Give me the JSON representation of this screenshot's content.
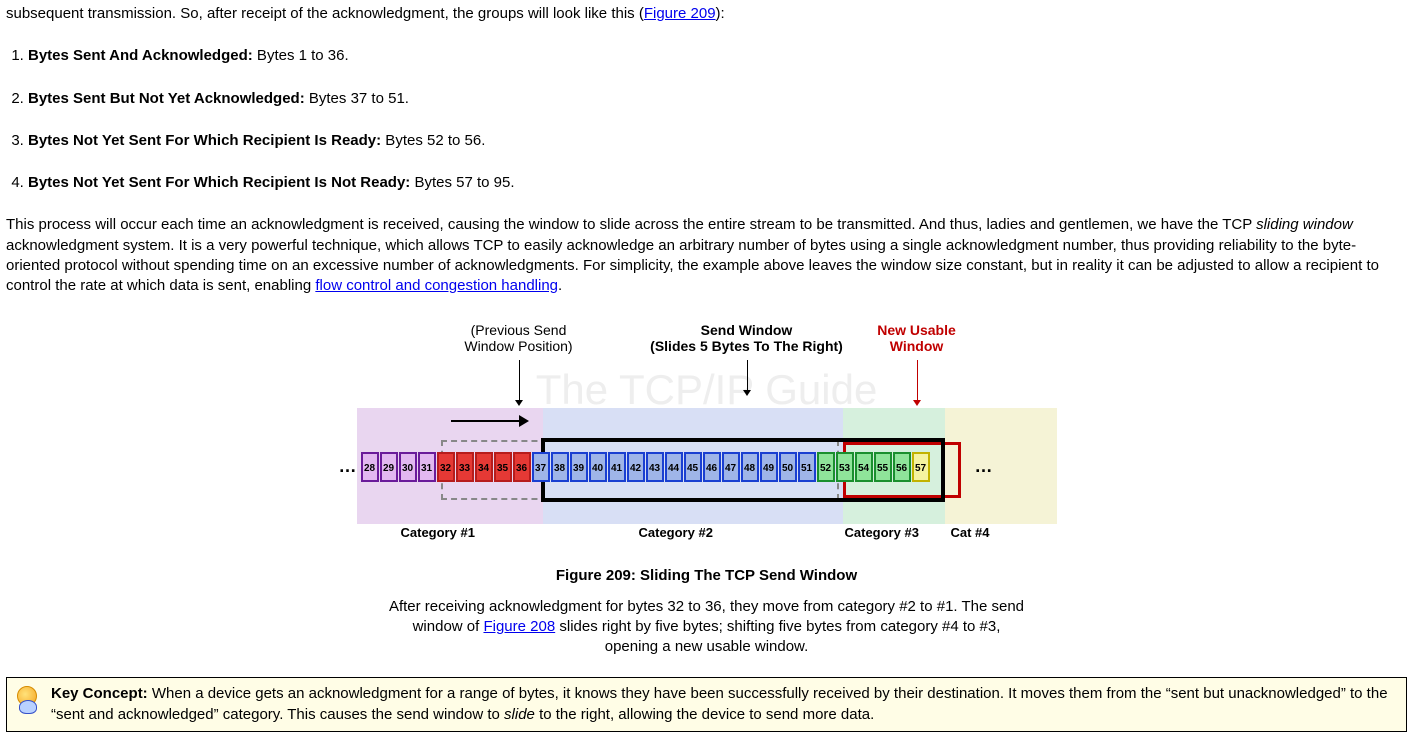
{
  "intro_fragment_pre": "subsequent transmission. So, after receipt of the acknowledgment, the groups will look like this (",
  "intro_link": "Figure 209",
  "intro_fragment_post": "):",
  "groups": [
    {
      "label": "Bytes Sent And Acknowledged:",
      "value": " Bytes 1 to 36."
    },
    {
      "label": "Bytes Sent But Not Yet Acknowledged:",
      "value": " Bytes 37 to 51."
    },
    {
      "label": "Bytes Not Yet Sent For Which Recipient Is Ready:",
      "value": " Bytes 52 to 56."
    },
    {
      "label": "Bytes Not Yet Sent For Which Recipient Is Not Ready:",
      "value": " Bytes 57 to 95."
    }
  ],
  "para_a": "This process will occur each time an acknowledgment is received, causing the window to slide across the entire stream to be transmitted. And thus, ladies and gentlemen, we have the TCP ",
  "para_italic": "sliding window",
  "para_b": " acknowledgment system. It is a very powerful technique, which allows TCP to easily acknowledge an arbitrary number of bytes using a single acknowledgment number, thus providing reliability to the byte-oriented protocol without spending time on an excessive number of acknowledgments. For simplicity, the example above leaves the window size constant, but in reality it can be adjusted to allow a recipient to control the rate at which data is sent, enabling ",
  "para_link": "flow control and congestion handling",
  "para_c": ".",
  "watermark": "The TCP/IP Guide",
  "ann_prev_l1": "(Previous Send",
  "ann_prev_l2": "Window Position)",
  "ann_send_l1": "Send Window",
  "ann_send_l2": "(Slides 5 Bytes To The Right)",
  "ann_usable_l1": "New Usable",
  "ann_usable_l2": "Window",
  "dots": "…",
  "bytes": [
    {
      "n": "28",
      "cls": "b-purple"
    },
    {
      "n": "29",
      "cls": "b-purple"
    },
    {
      "n": "30",
      "cls": "b-purple"
    },
    {
      "n": "31",
      "cls": "b-purple"
    },
    {
      "n": "32",
      "cls": "b-red"
    },
    {
      "n": "33",
      "cls": "b-red"
    },
    {
      "n": "34",
      "cls": "b-red"
    },
    {
      "n": "35",
      "cls": "b-red"
    },
    {
      "n": "36",
      "cls": "b-red"
    },
    {
      "n": "37",
      "cls": "b-blue"
    },
    {
      "n": "38",
      "cls": "b-blue"
    },
    {
      "n": "39",
      "cls": "b-blue"
    },
    {
      "n": "40",
      "cls": "b-blue"
    },
    {
      "n": "41",
      "cls": "b-blue"
    },
    {
      "n": "42",
      "cls": "b-blue"
    },
    {
      "n": "43",
      "cls": "b-blue"
    },
    {
      "n": "44",
      "cls": "b-blue"
    },
    {
      "n": "45",
      "cls": "b-blue"
    },
    {
      "n": "46",
      "cls": "b-blue"
    },
    {
      "n": "47",
      "cls": "b-blue"
    },
    {
      "n": "48",
      "cls": "b-blue"
    },
    {
      "n": "49",
      "cls": "b-blue"
    },
    {
      "n": "50",
      "cls": "b-blue"
    },
    {
      "n": "51",
      "cls": "b-blue"
    },
    {
      "n": "52",
      "cls": "b-green"
    },
    {
      "n": "53",
      "cls": "b-green"
    },
    {
      "n": "54",
      "cls": "b-green"
    },
    {
      "n": "55",
      "cls": "b-green"
    },
    {
      "n": "56",
      "cls": "b-green"
    },
    {
      "n": "57",
      "cls": "b-yellow"
    }
  ],
  "cat1": "Category #1",
  "cat2": "Category #2",
  "cat3": "Category #3",
  "cat4": "Cat #4",
  "fig_caption": "Figure 209: Sliding The TCP Send Window",
  "fig_desc_a": "After receiving acknowledgment for bytes 32 to 36, they move from category #2 to #1. The send window of ",
  "fig_desc_link": "Figure 208",
  "fig_desc_b": " slides right by five bytes; shifting five bytes from category #4 to #3, opening a new usable window.",
  "kc_label": "Key Concept:",
  "kc_text_a": " When a device gets an acknowledgment for a range of bytes, it knows they have been successfully received by their destination. It moves them from the “sent but unacknowledged” to the “sent and acknowledged” category. This causes the send window to ",
  "kc_italic": "slide",
  "kc_text_b": " to the right, allowing the device to send more data."
}
